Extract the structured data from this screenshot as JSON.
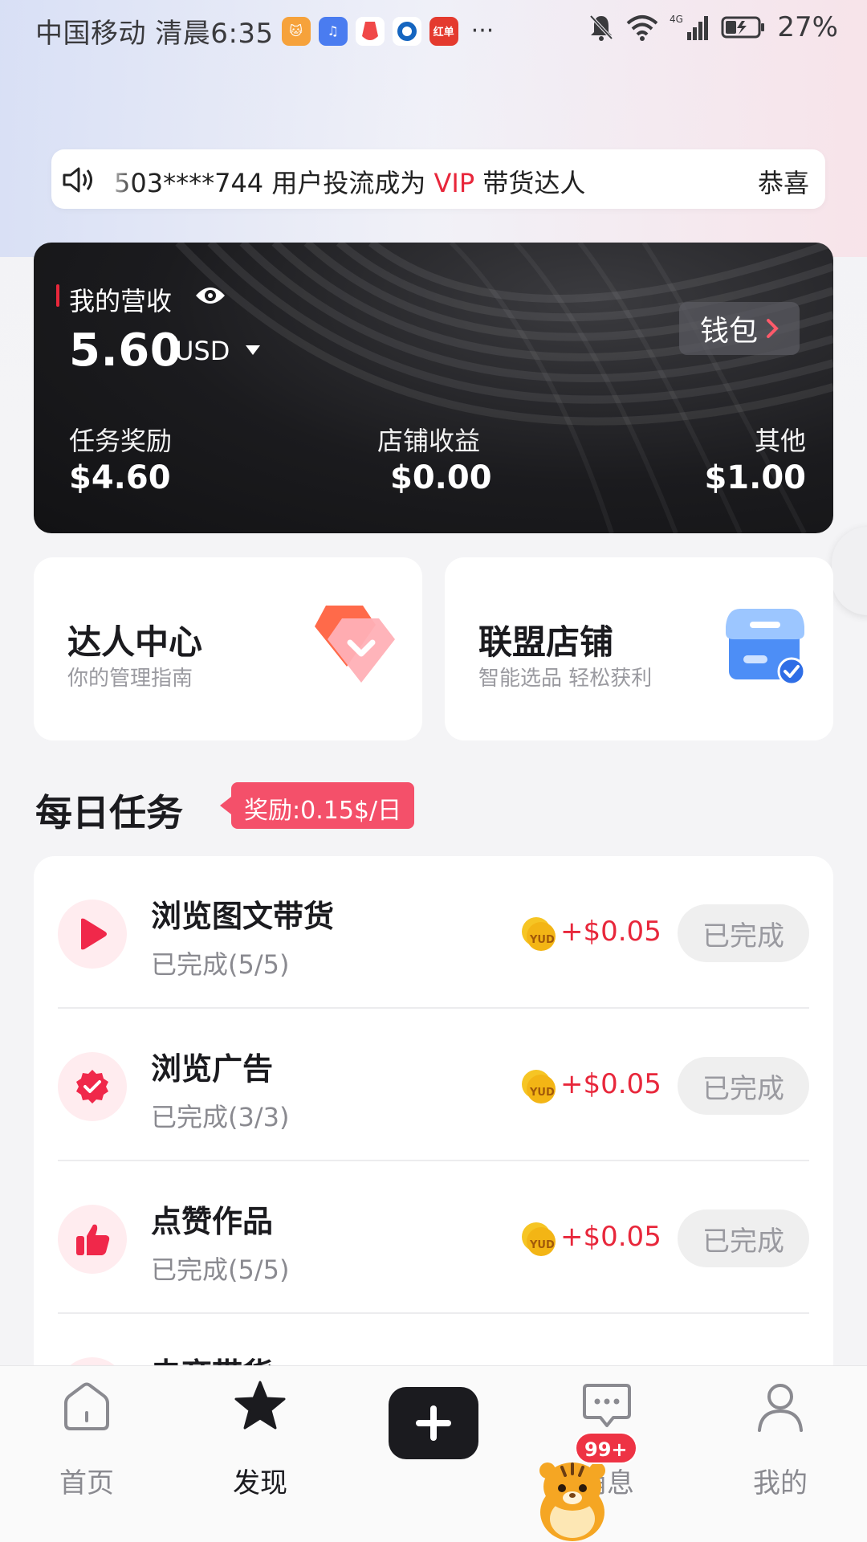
{
  "status_bar": {
    "carrier_time": "中国移动 清晨6:35",
    "more": "···",
    "network": "4G",
    "battery": "27%",
    "app_icons": [
      "cat-app-icon",
      "music-app-icon",
      "red-app-icon",
      "blue-app-icon",
      "hongdan-app-icon"
    ],
    "hongdan_label": "红单"
  },
  "marquee": {
    "prefix": "503****744 用户投流成为 ",
    "vip": "VIP",
    "suffix": " 带货达人",
    "next": "恭喜"
  },
  "revenue": {
    "title": "我的营收",
    "amount": "5.60",
    "currency": "USD",
    "wallet": "钱包",
    "columns": [
      {
        "label": "任务奖励",
        "value": "$4.60"
      },
      {
        "label": "店铺收益",
        "value": "$0.00"
      },
      {
        "label": "其他",
        "value": "$1.00"
      }
    ]
  },
  "entries": [
    {
      "title": "达人中心",
      "subtitle": "你的管理指南"
    },
    {
      "title": "联盟店铺",
      "subtitle": "智能选品 轻松获利"
    }
  ],
  "daily_tasks": {
    "title": "每日任务",
    "reward_tag": "奖励:0.15$/日",
    "coin_label": "YUD",
    "items": [
      {
        "name": "浏览图文带货",
        "status": "已完成(5/5)",
        "reward": "+$0.05",
        "button": "已完成",
        "icon": "play-icon"
      },
      {
        "name": "浏览广告",
        "status": "已完成(3/3)",
        "reward": "+$0.05",
        "button": "已完成",
        "icon": "verified-badge-icon"
      },
      {
        "name": "点赞作品",
        "status": "已完成(5/5)",
        "reward": "+$0.05",
        "button": "已完成",
        "icon": "thumbs-up-icon"
      },
      {
        "name": "电商带货",
        "status": "",
        "reward": "",
        "button": "",
        "icon": "partial-icon"
      }
    ]
  },
  "bottom_nav": {
    "items": [
      {
        "label": "首页",
        "icon": "home-icon"
      },
      {
        "label": "发现",
        "icon": "star-icon"
      },
      {
        "label": "消息",
        "icon": "message-icon"
      },
      {
        "label": "我的",
        "icon": "profile-icon"
      }
    ],
    "badge": "99+"
  },
  "colors": {
    "accent_red": "#e8273b",
    "tag_pink": "#f4506a",
    "card_dark": "#1b1b1e"
  }
}
